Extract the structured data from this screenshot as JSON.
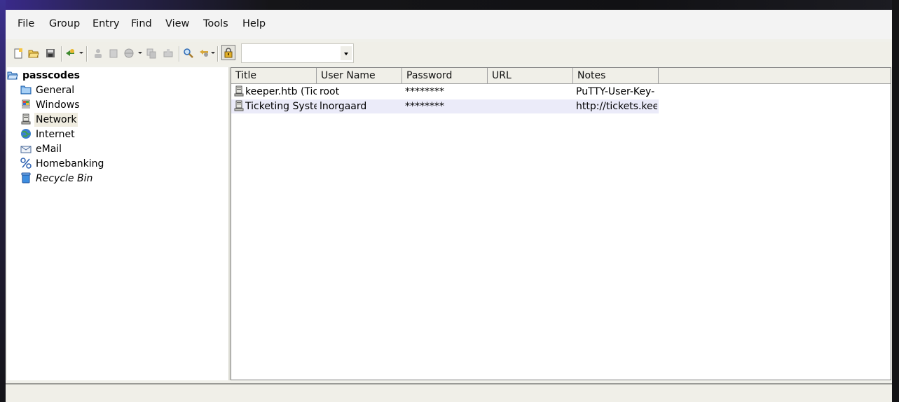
{
  "menu": {
    "items": [
      {
        "label": "File"
      },
      {
        "label": "Group"
      },
      {
        "label": "Entry"
      },
      {
        "label": "Find"
      },
      {
        "label": "View"
      },
      {
        "label": "Tools"
      },
      {
        "label": "Help"
      }
    ]
  },
  "toolbar": {
    "buttons": [
      {
        "icon": "new-database-icon"
      },
      {
        "icon": "open-database-icon"
      },
      {
        "icon": "save-database-icon"
      },
      {
        "icon": "add-entry-icon"
      },
      {
        "icon": "copy-username-icon"
      },
      {
        "icon": "copy-password-icon"
      },
      {
        "icon": "open-url-icon"
      },
      {
        "icon": "copy-entry-icon"
      },
      {
        "icon": "autotype-icon"
      },
      {
        "icon": "find-icon"
      },
      {
        "icon": "find-options-icon"
      },
      {
        "icon": "lock-workspace-icon"
      }
    ],
    "quick_find_value": ""
  },
  "tree": {
    "root": {
      "label": "passcodes",
      "icon": "folder-open-icon"
    },
    "groups": [
      {
        "label": "General",
        "icon": "folder-icon"
      },
      {
        "label": "Windows",
        "icon": "windows-icon"
      },
      {
        "label": "Network",
        "icon": "network-icon",
        "selected": true
      },
      {
        "label": "Internet",
        "icon": "globe-icon"
      },
      {
        "label": "eMail",
        "icon": "email-icon"
      },
      {
        "label": "Homebanking",
        "icon": "percent-icon"
      },
      {
        "label": "Recycle Bin",
        "icon": "recycle-bin-icon",
        "italic": true
      }
    ]
  },
  "entries": {
    "columns": [
      "Title",
      "User Name",
      "Password",
      "URL",
      "Notes"
    ],
    "rows": [
      {
        "title": "keeper.htb (Tick",
        "username": "root",
        "password": "********",
        "url": "",
        "notes": "PuTTY-User-Key-"
      },
      {
        "title": "Ticketing Syster",
        "username": "lnorgaard",
        "password": "********",
        "url": "",
        "notes": "http://tickets.keep"
      }
    ]
  },
  "colors": {
    "window_bg": "#f0f0ea",
    "selected_row": "#ebebf9",
    "selected_tree_item": "#efece0"
  }
}
